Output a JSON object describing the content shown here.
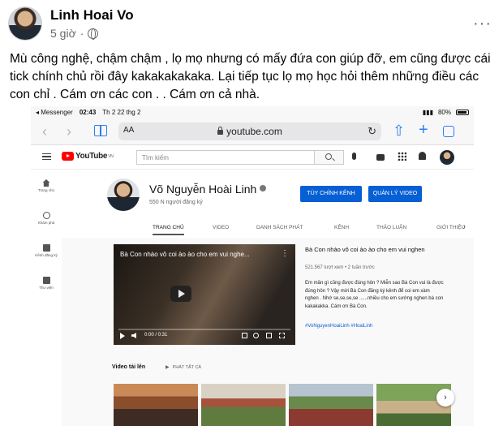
{
  "post": {
    "author": "Linh Hoai Vo",
    "time": "5 giờ",
    "separator": "·",
    "text": "Mù công nghệ, chậm chậm , lọ mọ nhưng có mấy đứa con giúp đỡ, em cũng được cái tick chính chủ rồi đây kakakakakaka. Lại tiếp tục lọ mọ học hỏi thêm những điều các con chỉ . Cám ơn các con . . Cám ơn cả nhà.",
    "more": "···"
  },
  "ios_status": {
    "back_app": "◂ Messenger",
    "time": "02:43",
    "date": "Th 2 22 thg 2",
    "battery": "80%"
  },
  "safari": {
    "back": "‹",
    "forward": "›",
    "aa": "AA",
    "url": "youtube.com",
    "reload": "↻",
    "share": "⇧",
    "new_tab": "+"
  },
  "youtube": {
    "logo": "YouTube",
    "logo_region": "VN",
    "search_placeholder": "Tìm kiếm",
    "sidebar": [
      {
        "label": "Trang chủ",
        "icon": "home-icon"
      },
      {
        "label": "Khám phá",
        "icon": "explore-icon"
      },
      {
        "label": "Kênh đăng ký",
        "icon": "subscriptions-icon"
      },
      {
        "label": "Thư viện",
        "icon": "library-icon"
      }
    ],
    "channel": {
      "name": "Võ Nguyễn Hoài Linh",
      "subscribers": "550 N người đăng ký",
      "customize_button": "TÙY CHỈNH KÊNH",
      "manage_button": "QUẢN LÝ VIDEO",
      "tabs": [
        "TRANG CHỦ",
        "VIDEO",
        "DANH SÁCH PHÁT",
        "KÊNH",
        "THẢO LUẬN",
        "GIỚI THIỆU"
      ],
      "tabs_next": "›"
    },
    "featured": {
      "overlay_title": "Bà Con nhào vô coi ào ào cho em vui nghe...",
      "menu": "⋮",
      "time": "0:00 / 0:31",
      "progress": 0,
      "title": "Bà Con nhào vô coi ào ào cho em vui nghen",
      "stats": "521.567 lượt xem • 2 tuần trước",
      "description": "Em mần gì cũng được đúng hôn ? Miễn sao Bà Con vui là được đúng hôn ? Vậy mời Bà Con đăng ký kênh để coi em xàm nghen . Nhớ se,se,se,se ......nhiều cho em sướng nghen bà con kakakakka. Cám ơn Bà Con.",
      "hashtags": "#VoNguyenHoaiLinh #HoaiLinh"
    },
    "uploads": {
      "heading": "Video tải lên",
      "play_all": "PHÁT TẤT CẢ",
      "next": "›"
    }
  },
  "colors": {
    "youtube_red": "#ff0000",
    "youtube_blue": "#065fd4",
    "ios_blue": "#2f7cf6",
    "meta_gray": "#65676b"
  }
}
